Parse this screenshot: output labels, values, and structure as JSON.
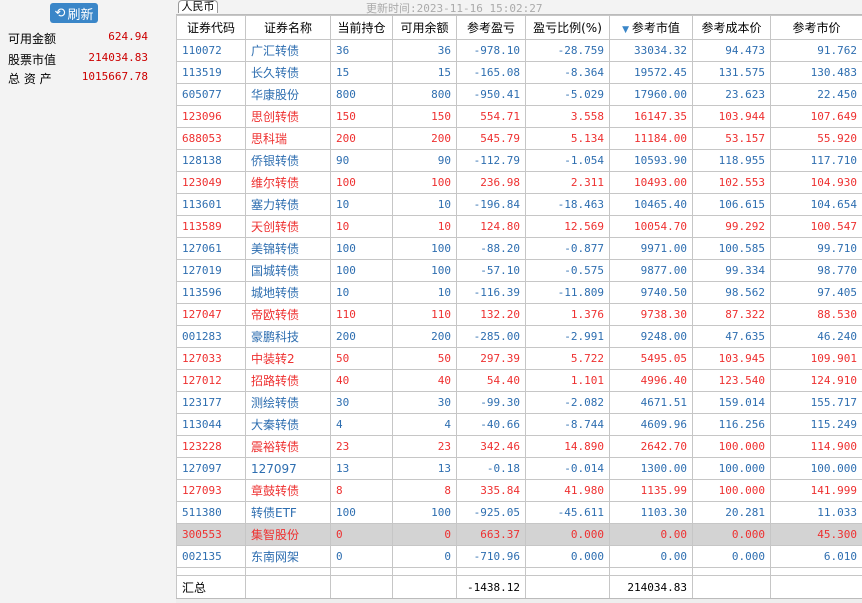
{
  "sidebar": {
    "refresh_label": "刷新",
    "account": [
      {
        "label": "可用金额",
        "value": "624.94"
      },
      {
        "label": "股票市值",
        "value": "214034.83"
      },
      {
        "label": "总 资 产",
        "value": "1015667.78"
      }
    ]
  },
  "tab": "人民币",
  "update_time": "更新时间:2023-11-16 15:02:27",
  "columns": [
    "证券代码",
    "证券名称",
    "当前持仓",
    "可用余额",
    "参考盈亏",
    "盈亏比例(%)",
    "参考市值",
    "参考成本价",
    "参考市价"
  ],
  "colors": {
    "blue": "#2e6eb0",
    "red": "#ee3030"
  },
  "rows": [
    {
      "c": "red0",
      "d": [
        "110072",
        "广汇转债",
        "36",
        "36",
        "-978.10",
        "-28.759",
        "33034.32",
        "94.473",
        "91.762"
      ],
      "color": "b"
    },
    {
      "d": [
        "113519",
        "长久转债",
        "15",
        "15",
        "-165.08",
        "-8.364",
        "19572.45",
        "131.575",
        "130.483"
      ],
      "color": "b"
    },
    {
      "d": [
        "605077",
        "华康股份",
        "800",
        "800",
        "-950.41",
        "-5.029",
        "17960.00",
        "23.623",
        "22.450"
      ],
      "color": "b"
    },
    {
      "d": [
        "123096",
        "思创转债",
        "150",
        "150",
        "554.71",
        "3.558",
        "16147.35",
        "103.944",
        "107.649"
      ],
      "color": "r"
    },
    {
      "d": [
        "688053",
        "思科瑞",
        "200",
        "200",
        "545.79",
        "5.134",
        "11184.00",
        "53.157",
        "55.920"
      ],
      "color": "r"
    },
    {
      "d": [
        "128138",
        "侨银转债",
        "90",
        "90",
        "-112.79",
        "-1.054",
        "10593.90",
        "118.955",
        "117.710"
      ],
      "color": "b"
    },
    {
      "d": [
        "123049",
        "维尔转债",
        "100",
        "100",
        "236.98",
        "2.311",
        "10493.00",
        "102.553",
        "104.930"
      ],
      "color": "r"
    },
    {
      "d": [
        "113601",
        "塞力转债",
        "10",
        "10",
        "-196.84",
        "-18.463",
        "10465.40",
        "106.615",
        "104.654"
      ],
      "color": "b"
    },
    {
      "d": [
        "113589",
        "天创转债",
        "10",
        "10",
        "124.80",
        "12.569",
        "10054.70",
        "99.292",
        "100.547"
      ],
      "color": "r"
    },
    {
      "d": [
        "127061",
        "美锦转债",
        "100",
        "100",
        "-88.20",
        "-0.877",
        "9971.00",
        "100.585",
        "99.710"
      ],
      "color": "b"
    },
    {
      "d": [
        "127019",
        "国城转债",
        "100",
        "100",
        "-57.10",
        "-0.575",
        "9877.00",
        "99.334",
        "98.770"
      ],
      "color": "b"
    },
    {
      "d": [
        "113596",
        "城地转债",
        "10",
        "10",
        "-116.39",
        "-11.809",
        "9740.50",
        "98.562",
        "97.405"
      ],
      "color": "b"
    },
    {
      "d": [
        "127047",
        "帝欧转债",
        "110",
        "110",
        "132.20",
        "1.376",
        "9738.30",
        "87.322",
        "88.530"
      ],
      "color": "r"
    },
    {
      "d": [
        "001283",
        "豪鹏科技",
        "200",
        "200",
        "-285.00",
        "-2.991",
        "9248.00",
        "47.635",
        "46.240"
      ],
      "color": "b"
    },
    {
      "d": [
        "127033",
        "中装转2",
        "50",
        "50",
        "297.39",
        "5.722",
        "5495.05",
        "103.945",
        "109.901"
      ],
      "color": "r"
    },
    {
      "d": [
        "127012",
        "招路转债",
        "40",
        "40",
        "54.40",
        "1.101",
        "4996.40",
        "123.540",
        "124.910"
      ],
      "color": "r"
    },
    {
      "d": [
        "123177",
        "测绘转债",
        "30",
        "30",
        "-99.30",
        "-2.082",
        "4671.51",
        "159.014",
        "155.717"
      ],
      "color": "b"
    },
    {
      "d": [
        "113044",
        "大秦转债",
        "4",
        "4",
        "-40.66",
        "-8.744",
        "4609.96",
        "116.256",
        "115.249"
      ],
      "color": "b"
    },
    {
      "d": [
        "123228",
        "震裕转债",
        "23",
        "23",
        "342.46",
        "14.890",
        "2642.70",
        "100.000",
        "114.900"
      ],
      "color": "r"
    },
    {
      "d": [
        "127097",
        "127097",
        "13",
        "13",
        "-0.18",
        "-0.014",
        "1300.00",
        "100.000",
        "100.000"
      ],
      "color": "b"
    },
    {
      "d": [
        "127093",
        "章鼓转债",
        "8",
        "8",
        "335.84",
        "41.980",
        "1135.99",
        "100.000",
        "141.999"
      ],
      "color": "r"
    },
    {
      "d": [
        "511380",
        "转债ETF",
        "100",
        "100",
        "-925.05",
        "-45.611",
        "1103.30",
        "20.281",
        "11.033"
      ],
      "color": "b"
    },
    {
      "d": [
        "300553",
        "集智股份",
        "0",
        "0",
        "663.37",
        "0.000",
        "0.00",
        "0.000",
        "45.300"
      ],
      "color": "r",
      "selected": true
    },
    {
      "d": [
        "002135",
        "东南网架",
        "0",
        "0",
        "-710.96",
        "0.000",
        "0.00",
        "0.000",
        "6.010"
      ],
      "color": "b"
    }
  ],
  "summary": {
    "label": "汇总",
    "pnl": "-1438.12",
    "value": "214034.83"
  }
}
